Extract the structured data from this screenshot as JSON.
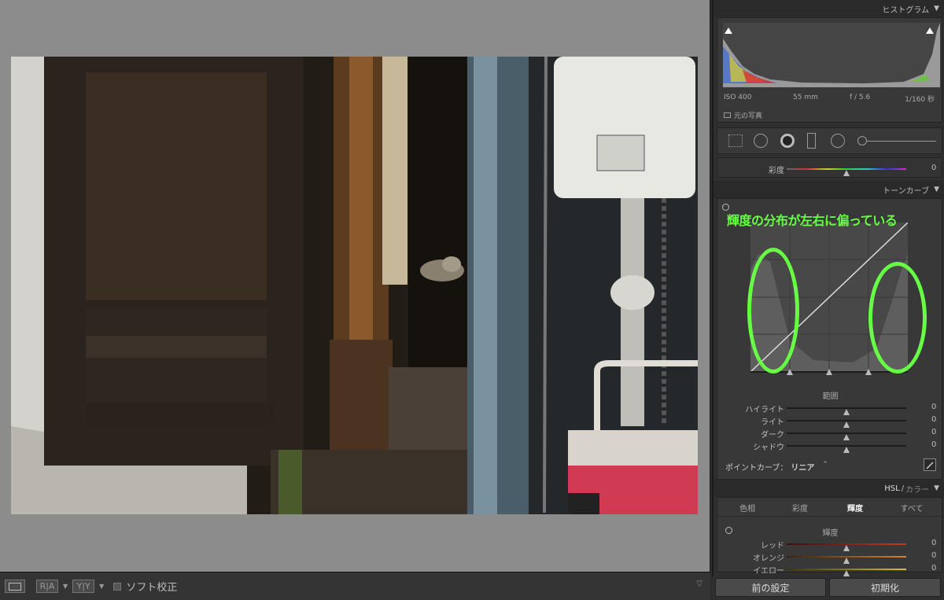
{
  "toolbar": {
    "view_mode_icon": "single-view-icon",
    "compare_ra_label": "R|A",
    "compare_yy_label": "Y|Y",
    "soft_proof_label": "ソフト校正"
  },
  "histogram": {
    "title": "ヒストグラム",
    "iso": "ISO 400",
    "focal": "55 mm",
    "aperture": "f / 5.6",
    "shutter": "1/160 秒",
    "original_photo_label": "元の写真"
  },
  "tools": [
    "crop-overlay-icon",
    "spot-removal-icon",
    "red-eye-icon",
    "graduated-filter-icon",
    "radial-filter-icon",
    "adjustment-brush-icon"
  ],
  "basic_partial": {
    "saturation_label": "彩度",
    "saturation_value": "0"
  },
  "tone_curve": {
    "title": "トーンカーブ",
    "annotation": "輝度の分布が左右に偏っている",
    "region_title": "範囲",
    "sliders": [
      {
        "label": "ハイライト",
        "value": "0"
      },
      {
        "label": "ライト",
        "value": "0"
      },
      {
        "label": "ダーク",
        "value": "0"
      },
      {
        "label": "シャドウ",
        "value": "0"
      }
    ],
    "point_curve_label": "ポイントカーブ：",
    "point_curve_value": "リニア",
    "point_curve_arrow": "⌃"
  },
  "hsl": {
    "title_hsl": "HSL",
    "title_sep": "/",
    "title_color": "カラー",
    "tabs": [
      "色相",
      "彩度",
      "輝度",
      "すべて"
    ],
    "active_tab": "輝度",
    "section_title": "輝度",
    "sliders": [
      {
        "label": "レッド",
        "value": "0",
        "color": "#c0392b"
      },
      {
        "label": "オレンジ",
        "value": "0",
        "color": "#d9822b"
      },
      {
        "label": "イエロー",
        "value": "0",
        "color": "#d4c22b"
      }
    ]
  },
  "buttons": {
    "previous": "前の設定",
    "reset": "初期化"
  },
  "colors": {
    "annotation_green": "#66ff44",
    "panel_bg": "#383838"
  }
}
